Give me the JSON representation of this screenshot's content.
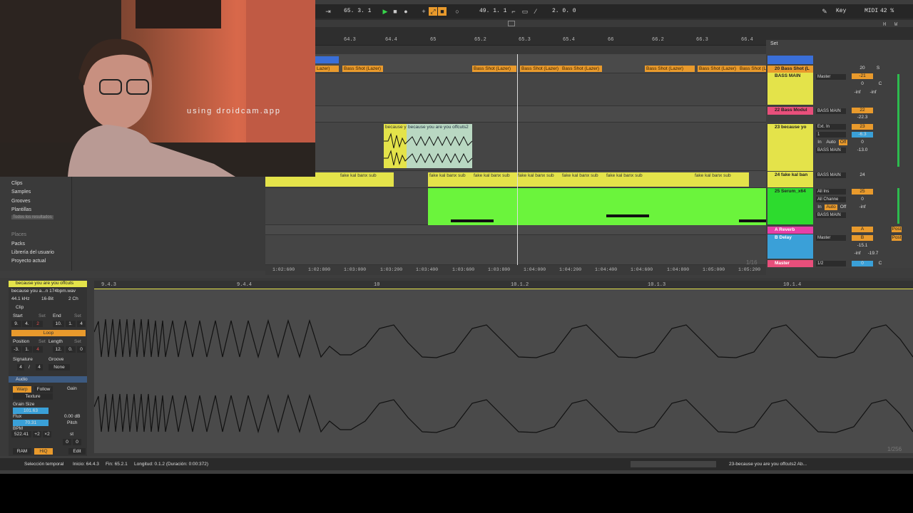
{
  "webcam": {
    "watermark": "using droidcam.app"
  },
  "control_bar": {
    "arr_position": "65.  3.  1",
    "loop_start": "49.  1.  1",
    "loop_length": "2.  0.  0",
    "key_label": "Key",
    "midi_label": "MIDI",
    "cpu": "42 %",
    "h": "H",
    "w": "W"
  },
  "ruler": {
    "ticks": [
      "64.3",
      "64.4",
      "65",
      "65.2",
      "65.3",
      "65.4",
      "66",
      "66.2",
      "66.3",
      "66.4"
    ],
    "set_label": "Set"
  },
  "timeline": {
    "ticks": [
      "1:02:600",
      "1:02:800",
      "1:03:000",
      "1:03:200",
      "1:03:400",
      "1:03:600",
      "1:03:800",
      "1:04:000",
      "1:04:200",
      "1:04:400",
      "1:04:600",
      "1:04:800",
      "1:05:000",
      "1:05:200"
    ],
    "zoom": "1/16"
  },
  "clips": {
    "bass_shot": "Bass Shot (Lazer)",
    "lazer": "Lazer)",
    "because_a": "because y",
    "because_b": "because you are you offcuts2",
    "fake": "fake kal banx sub"
  },
  "tracks": [
    {
      "name": "20 Bass Shot (L",
      "color": "#e99a2c",
      "vol": "20",
      "input": "BASS MAIN",
      "v1": "-21",
      "v2": "0",
      "c": "C",
      "inf1": "-inf",
      "inf2": "-inf"
    },
    {
      "name": "22 Bass Modul",
      "color": "#e84f7b",
      "vol": "22",
      "input": "BASS MAIN",
      "v1": "-22.3"
    },
    {
      "name": "23 because yo",
      "color": "#e4e34a",
      "vol": "23",
      "input": "Ext. In",
      "ch": "1",
      "v1": "-6.3",
      "v2": "0",
      "v3": "-13.0",
      "in_label": "In",
      "auto_label": "Auto",
      "off_label": "Off",
      "route": "BASS MAIN"
    },
    {
      "name": "24 fake kal ban",
      "color": "#e4e34a",
      "vol": "24",
      "input": "BASS MAIN"
    },
    {
      "name": "25 Serum_x64",
      "color": "#6bf43c",
      "vol": "25",
      "input": "All Ins",
      "ch": "All Channe",
      "v2": "0",
      "inf1": "-inf",
      "in_label": "In",
      "auto_label": "Auto",
      "off_label": "Off",
      "route": "BASS MAIN"
    },
    {
      "name": "A Reverb",
      "color": "#e640a8",
      "vol": "A"
    },
    {
      "name": "B Delay",
      "color": "#3aa0d8",
      "vol": "B",
      "input": "Master",
      "v1": "-15.1",
      "v3": "-19.7",
      "inf1": "-inf",
      "post": "Post"
    },
    {
      "name": "Master",
      "color": "#e84f7b",
      "vol": "0",
      "input": "1/2",
      "v2": "0",
      "c": "C"
    }
  ],
  "mixer": {
    "s": "S",
    "c": "C",
    "post": "Post"
  },
  "browser": {
    "items": [
      "Clips",
      "Samples",
      "Grooves",
      "Plantillas",
      "Todos los resultados"
    ],
    "places_header": "Places",
    "places": [
      "Packs",
      "Librería del usuario",
      "Proyecto actual"
    ]
  },
  "clip_view": {
    "clip_name": "because you are you offcuts",
    "file": "because you a...n 174bpm.wav",
    "rate": "44.1 kHz",
    "bits": "16-Bit",
    "ch": "2 Ch",
    "clip_section": "Clip",
    "start": "Start",
    "end": "End",
    "set": "Set",
    "start_val": [
      "9.",
      "4.",
      "2"
    ],
    "end_val": [
      "10.",
      "1.",
      "4"
    ],
    "loop": "Loop",
    "position": "Position",
    "length": "Length",
    "pos_val": [
      "-3.",
      "1.",
      "4"
    ],
    "len_val": [
      "12.",
      "0.",
      "0"
    ],
    "signature": "Signature",
    "groove": "Groove",
    "sig_val": [
      "4",
      "/",
      "4"
    ],
    "groove_val": "None",
    "audio_section": "Audio",
    "warp": "Warp",
    "follow": "Follow",
    "gain": "Gain",
    "texture": "Texture",
    "grain_size": "Grain Size",
    "grain_val": "101.63",
    "flux": "Flux",
    "flux_val": "70.31",
    "gain_db": "0.00 dB",
    "pitch": "Pitch",
    "bpm": "BPM",
    "bpm_val": "522.41",
    "x2a": "+2",
    "x2b": "×2",
    "st": "st",
    "pitch_val": [
      "0",
      "0"
    ],
    "ram": "RAM",
    "hiq": "HiQ",
    "edit": "Edit",
    "ruler": [
      "9.4.3",
      "9.4.4",
      "10",
      "10.1.2",
      "10.1.3",
      "10.1.4"
    ],
    "zoom": "1/256"
  },
  "status": {
    "selection": "Selección temporal",
    "inicio": "Inicio: 64.4.3",
    "fin": "Fin: 65.2.1",
    "longitud": "Longitud: 0.1.2 (Duración: 0:00:372)",
    "track": "23-because you are you offcuts2 Ab..."
  }
}
